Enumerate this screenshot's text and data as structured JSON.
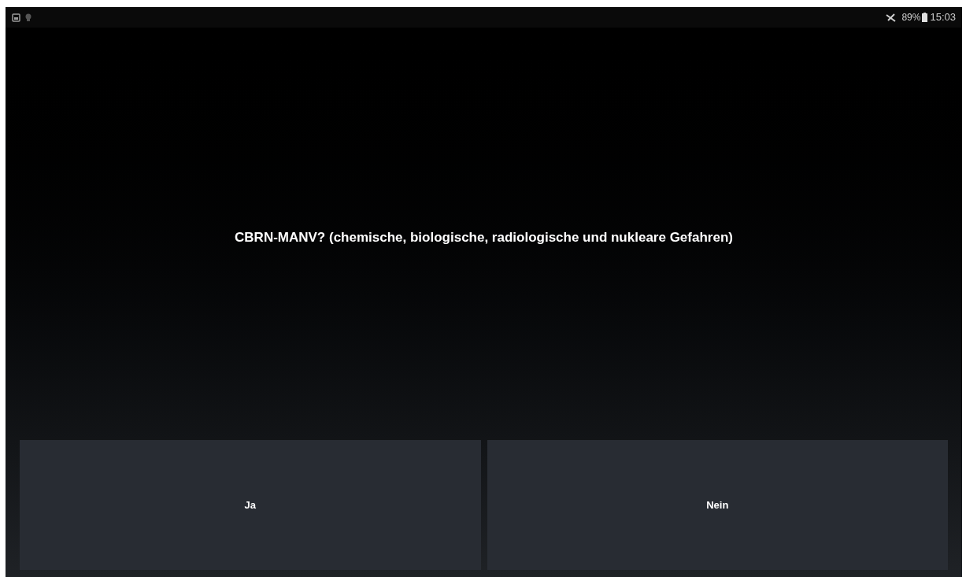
{
  "status_bar": {
    "battery": "89%",
    "time": "15:03"
  },
  "question": "CBRN-MANV? (chemische, biologische, radiologische und nukleare Gefahren)",
  "buttons": [
    {
      "label": "Ja"
    },
    {
      "label": "Nein"
    }
  ]
}
